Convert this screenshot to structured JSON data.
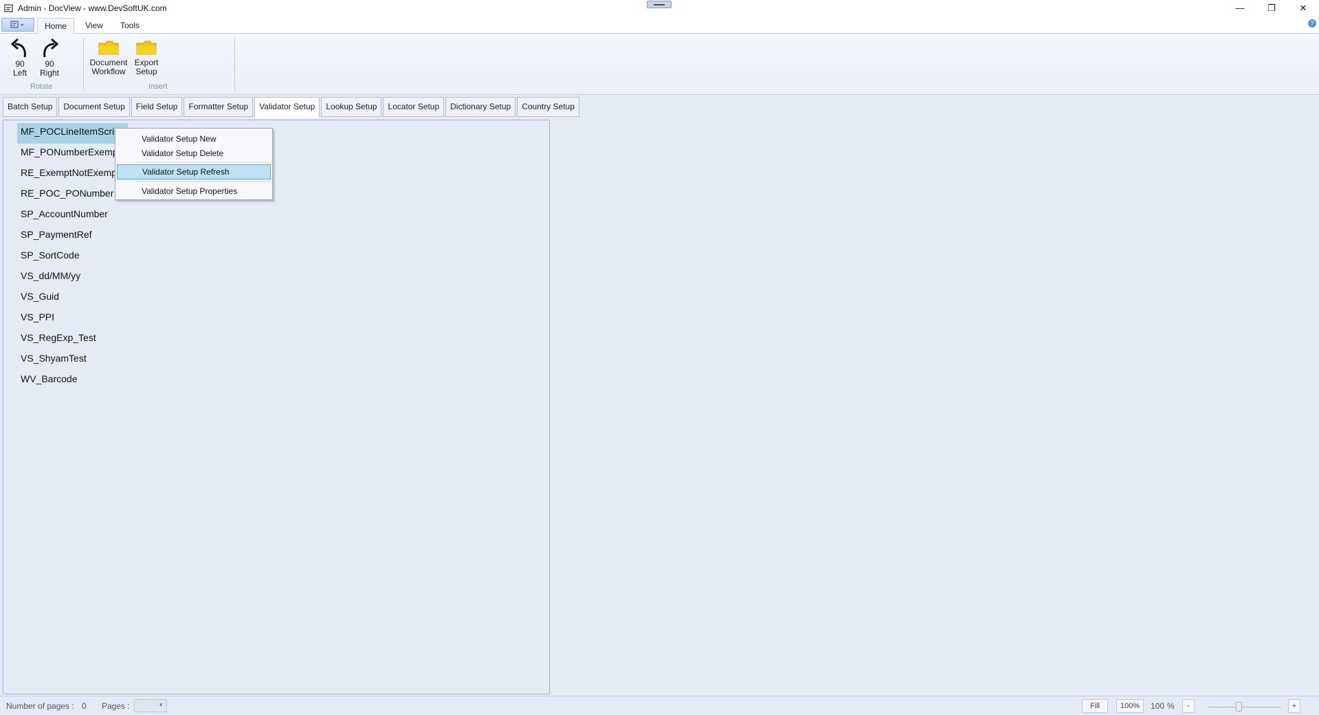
{
  "window": {
    "title": "Admin - DocView - www.DevSoftUK.com",
    "controls": {
      "minimize": "—",
      "restore": "❐",
      "close": "✕"
    }
  },
  "ribbon": {
    "tabs": [
      {
        "label": "Home",
        "active": true
      },
      {
        "label": "View",
        "active": false
      },
      {
        "label": "Tools",
        "active": false
      }
    ],
    "groups": {
      "rotate": {
        "label": "Rotate",
        "left": {
          "line1": "90",
          "line2": "Left"
        },
        "right": {
          "line1": "90",
          "line2": "Right"
        }
      },
      "insert": {
        "label": "Insert",
        "workflow": {
          "line1": "Document",
          "line2": "Workflow"
        },
        "export": {
          "line1": "Export",
          "line2": "Setup"
        }
      }
    },
    "help": "?"
  },
  "setup_tabs": [
    "Batch Setup",
    "Document Setup",
    "Field Setup",
    "Formatter Setup",
    "Validator Setup",
    "Lookup Setup",
    "Locator Setup",
    "Dictionary Setup",
    "Country Setup"
  ],
  "active_setup_tab": "Validator Setup",
  "validators": [
    "MF_POCLineItemScript",
    "MF_PONumberExempt",
    "RE_ExemptNotExempt",
    "RE_POC_PONumber",
    "SP_AccountNumber",
    "SP_PaymentRef",
    "SP_SortCode",
    "VS_dd/MM/yy",
    "VS_Guid",
    "VS_PPI",
    "VS_RegExp_Test",
    "VS_ShyamTest",
    "WV_Barcode"
  ],
  "context_menu": {
    "items": [
      "Validator Setup New",
      "Validator Setup Delete",
      "Validator Setup Refresh",
      "Validator Setup Properties"
    ],
    "highlighted": "Validator Setup Refresh"
  },
  "statusbar": {
    "num_pages_label": "Number of pages :",
    "num_pages_value": "0",
    "pages_label": "Pages :",
    "fill_label": "Fill",
    "hundred_label": "100%",
    "zoom_value": "100",
    "zoom_unit": "%",
    "zoom_out": "-",
    "zoom_in": "+"
  },
  "colors": {
    "background": "#e4ebf6",
    "selection": "#a8d2e6",
    "menu_highlight": "#bfe1f3",
    "folder": "#f5d229"
  }
}
